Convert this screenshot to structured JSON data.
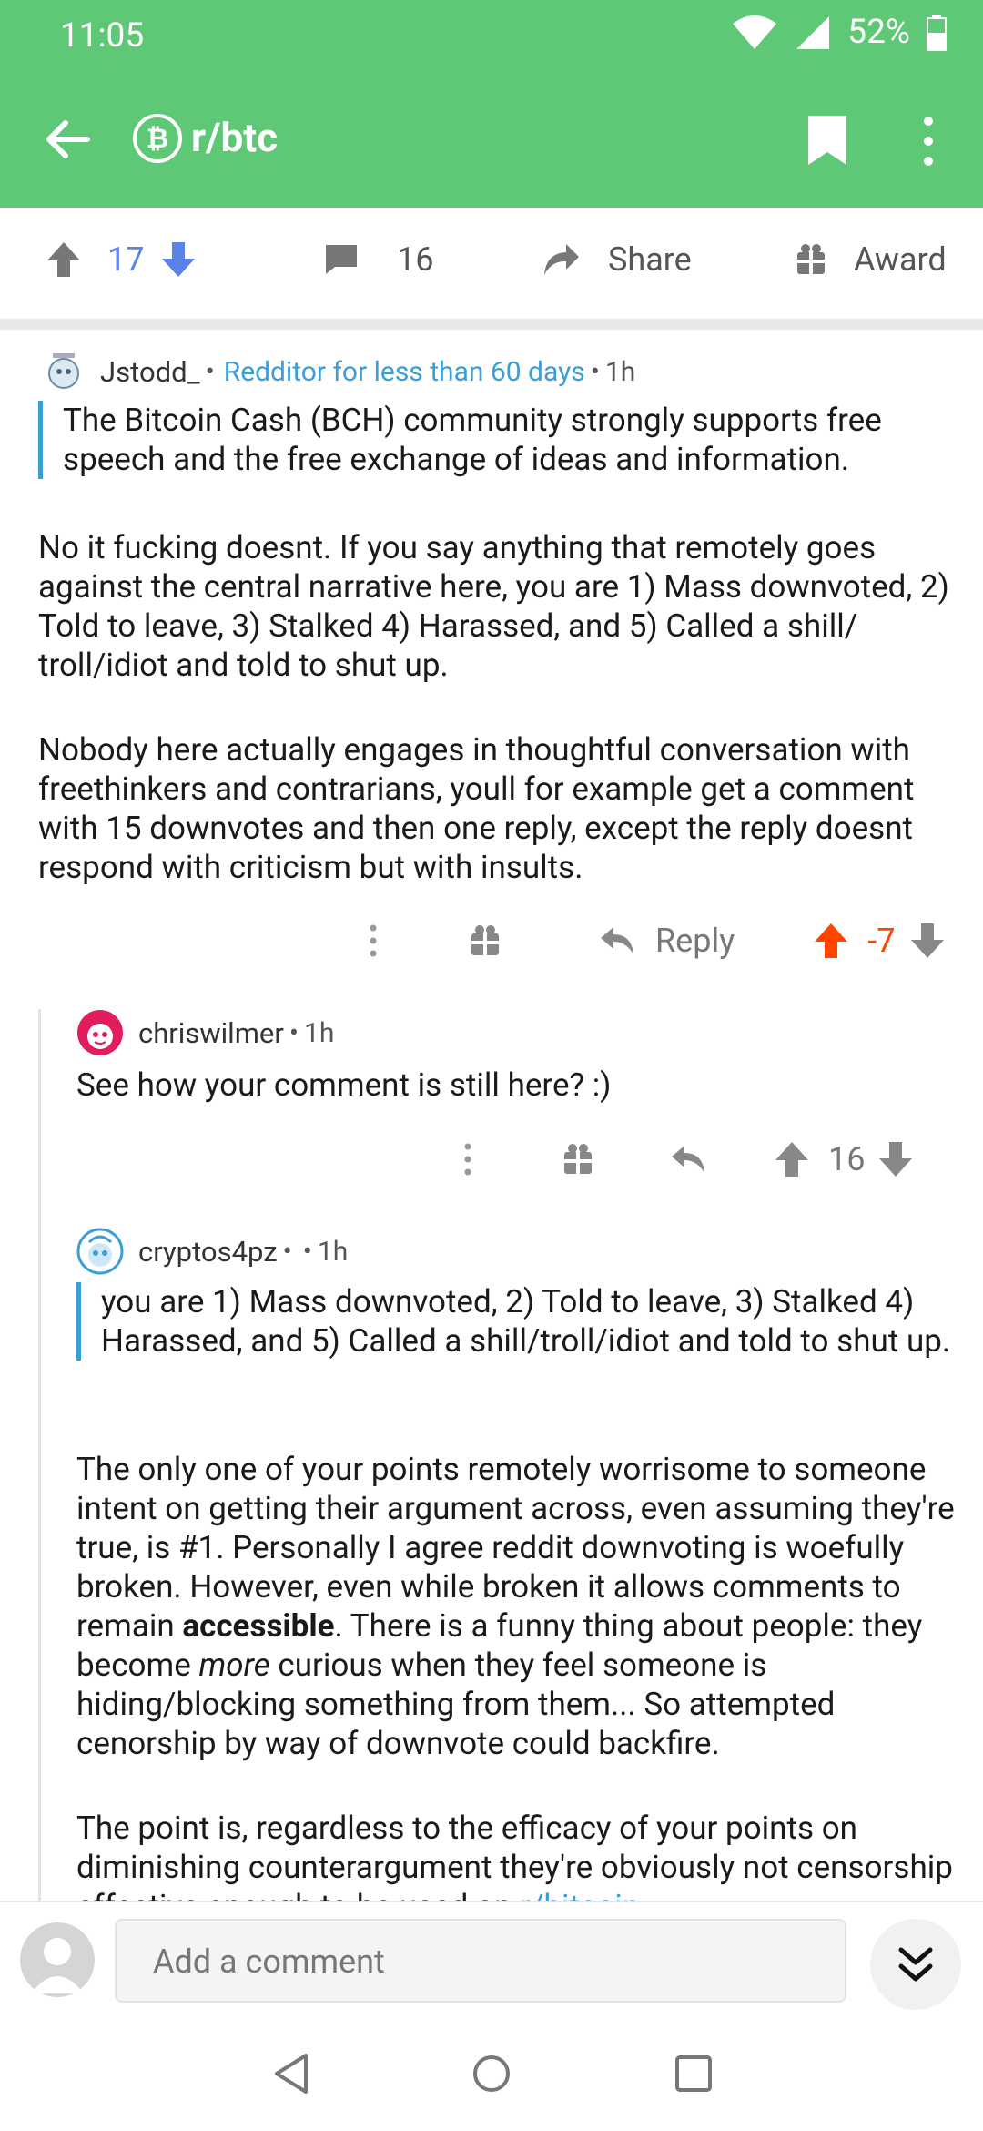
{
  "status": {
    "time": "11:05",
    "battery": "52%"
  },
  "toolbar": {
    "subreddit": "r/btc",
    "sub_icon": "bitcoin-icon"
  },
  "post_actions": {
    "upvotes": "17",
    "comments": "16",
    "share": "Share",
    "award": "Award"
  },
  "comments": [
    {
      "author": "Jstodd_",
      "flair": "Redditor for less than 60 days",
      "age": "1h",
      "quote": "The Bitcoin Cash (BCH) community strongly supports free speech and the free exchange of ideas and information.",
      "paragraphs": [
        "No it fucking doesnt. If you say anything that remotely goes against the central narrative here, you are 1) Mass downvoted, 2) Told to leave, 3) Stalked  4) Harassed, and 5) Called a shill/ troll/idiot and told to shut up.",
        "Nobody here actually engages in thoughtful conversation with freethinkers and contrarians, youll for example get a comment with 15 downvotes and then one reply, except the reply doesnt respond with criticism  but with insults."
      ],
      "reply_label": "Reply",
      "score": "-7"
    },
    {
      "author": "chriswilmer",
      "age": "1h",
      "text": "See how your comment is still here? :)",
      "score": "16"
    },
    {
      "author": "cryptos4pz",
      "age": "1h",
      "quote": "you are 1) Mass downvoted, 2) Told to leave, 3) Stalked 4) Harassed, and 5) Called a shill/troll/idiot and told to shut up.",
      "p1_a": "The only one of your points remotely worrisome to someone intent on getting their argument across, even assuming they're true, is #1. Personally I agree reddit downvoting is woefully broken. However, even while broken it allows comments to remain ",
      "p1_bold": "accessible",
      "p1_b": ". There is a funny thing about people: they become ",
      "p1_italic": "more",
      "p1_c": " curious when they feel someone is hiding/blocking something from them... So attempted cenorship by way of downvote could backfire.",
      "p2": "The point is, regardless to the efficacy of your points on diminishing counterargument they're obviously not censorship effective enough to be used on ",
      "p2_link": "r/bitcoin"
    }
  ],
  "composer": {
    "placeholder": "Add a comment"
  },
  "colors": {
    "header": "#5ec877",
    "link": "#3b9ed6",
    "upvoted": "#ff4500"
  }
}
